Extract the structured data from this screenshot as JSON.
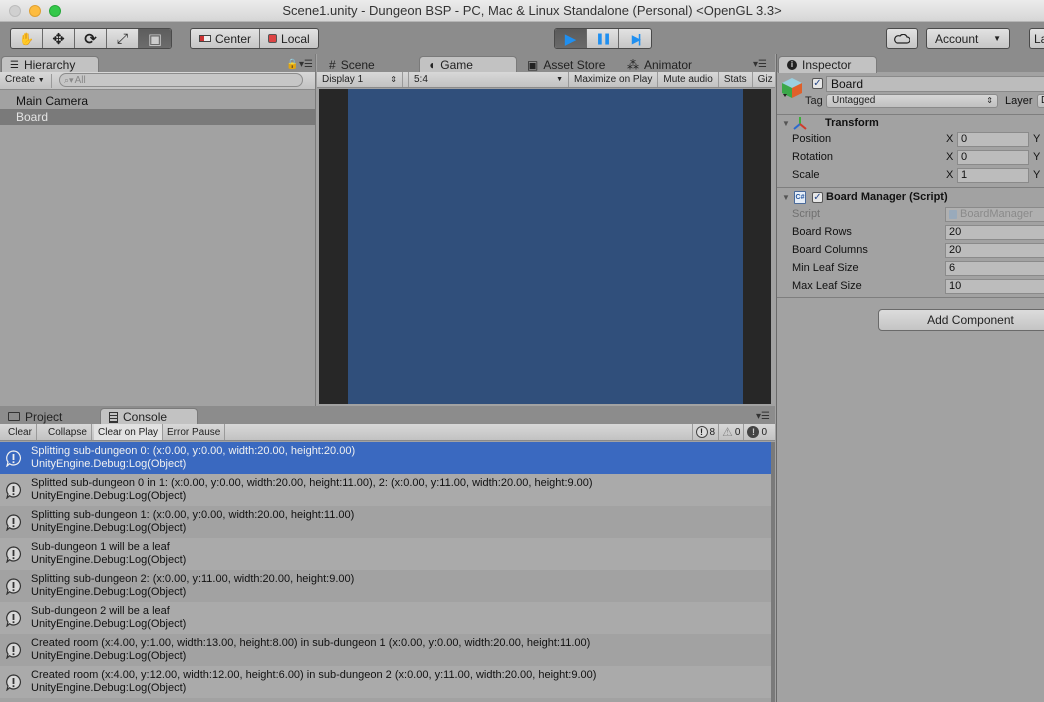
{
  "window": {
    "title": "Scene1.unity - Dungeon BSP - PC, Mac & Linux Standalone (Personal) <OpenGL 3.3>"
  },
  "toolbar": {
    "tools": [
      {
        "name": "hand-tool",
        "icon": "hand-icon",
        "glyph": "✋"
      },
      {
        "name": "move-tool",
        "icon": "move-icon",
        "glyph": "✥"
      },
      {
        "name": "rotate-tool",
        "icon": "rotate-icon",
        "glyph": "⟳"
      },
      {
        "name": "scale-tool",
        "icon": "scale-icon",
        "glyph": "⤢"
      },
      {
        "name": "rect-tool",
        "icon": "rect-icon",
        "glyph": "▣"
      }
    ],
    "pivot_label": "Center",
    "space_label": "Local",
    "play_glyph": "▶",
    "pause_glyph": "❚❚",
    "step_glyph": "▶|",
    "account_label": "Account",
    "layers_label": "La",
    "play_color": "#1f8ff0"
  },
  "hierarchy": {
    "tab_label": "Hierarchy",
    "create_label": "Create",
    "search_placeholder": "All",
    "items": [
      {
        "label": "Main Camera",
        "selected": false
      },
      {
        "label": "Board",
        "selected": true
      }
    ]
  },
  "center": {
    "tabs": [
      {
        "label": "Scene",
        "icon": "#"
      },
      {
        "label": "Game",
        "icon": "◖"
      },
      {
        "label": "Asset Store",
        "icon": "▣"
      },
      {
        "label": "Animator",
        "icon": "⁂"
      }
    ],
    "active_tab": "Game",
    "display": "Display 1",
    "aspect": "5:4",
    "maximize_label": "Maximize on Play",
    "mute_label": "Mute audio",
    "stats_label": "Stats",
    "gizmos_label": "Giz",
    "camera_bg_color": "#304f7b",
    "letterbox_color": "#272727"
  },
  "inspector": {
    "tab_label": "Inspector",
    "object_name": "Board",
    "active": true,
    "tag_label": "Tag",
    "tag_value": "Untagged",
    "layer_label": "Layer",
    "layer_value": "D",
    "transform": {
      "title": "Transform",
      "rows": [
        {
          "label": "Position",
          "x": "0",
          "axis": "X",
          "next_axis": "Y"
        },
        {
          "label": "Rotation",
          "x": "0",
          "axis": "X",
          "next_axis": "Y"
        },
        {
          "label": "Scale",
          "x": "1",
          "axis": "X",
          "next_axis": "Y"
        }
      ]
    },
    "script_component": {
      "title": "Board Manager (Script)",
      "enabled": true,
      "script_label": "Script",
      "script_value": "BoardManager",
      "fields": [
        {
          "label": "Board Rows",
          "value": "20"
        },
        {
          "label": "Board Columns",
          "value": "20"
        },
        {
          "label": "Min Leaf Size",
          "value": "6"
        },
        {
          "label": "Max Leaf Size",
          "value": "10"
        }
      ]
    },
    "add_component_label": "Add Component"
  },
  "console": {
    "tabs": [
      {
        "label": "Project",
        "icon": "folder"
      },
      {
        "label": "Console",
        "icon": "console"
      }
    ],
    "active_tab": "Console",
    "buttons": [
      {
        "label": "Clear",
        "on": false
      },
      {
        "label": "Collapse",
        "on": false
      },
      {
        "label": "Clear on Play",
        "on": true
      },
      {
        "label": "Error Pause",
        "on": false
      }
    ],
    "counts": {
      "info": "8",
      "warnings": "0",
      "errors": "0"
    },
    "selected_color": "#3a69c0",
    "entries": [
      {
        "message": "Splitting sub-dungeon 0: (x:0.00, y:0.00, width:20.00, height:20.00)",
        "trace": "UnityEngine.Debug:Log(Object)",
        "selected": true
      },
      {
        "message": "Splitted sub-dungeon 0 in 1: (x:0.00, y:0.00, width:20.00, height:11.00), 2: (x:0.00, y:11.00, width:20.00, height:9.00)",
        "trace": "UnityEngine.Debug:Log(Object)",
        "selected": false
      },
      {
        "message": "Splitting sub-dungeon 1: (x:0.00, y:0.00, width:20.00, height:11.00)",
        "trace": "UnityEngine.Debug:Log(Object)",
        "selected": false
      },
      {
        "message": "Sub-dungeon 1 will be a leaf",
        "trace": "UnityEngine.Debug:Log(Object)",
        "selected": false
      },
      {
        "message": "Splitting sub-dungeon 2: (x:0.00, y:11.00, width:20.00, height:9.00)",
        "trace": "UnityEngine.Debug:Log(Object)",
        "selected": false
      },
      {
        "message": "Sub-dungeon 2 will be a leaf",
        "trace": "UnityEngine.Debug:Log(Object)",
        "selected": false
      },
      {
        "message": "Created room (x:4.00, y:1.00, width:13.00, height:8.00) in sub-dungeon 1 (x:0.00, y:0.00, width:20.00, height:11.00)",
        "trace": "UnityEngine.Debug:Log(Object)",
        "selected": false
      },
      {
        "message": "Created room (x:4.00, y:12.00, width:12.00, height:6.00) in sub-dungeon 2 (x:0.00, y:11.00, width:20.00, height:9.00)",
        "trace": "UnityEngine.Debug:Log(Object)",
        "selected": false
      }
    ]
  }
}
